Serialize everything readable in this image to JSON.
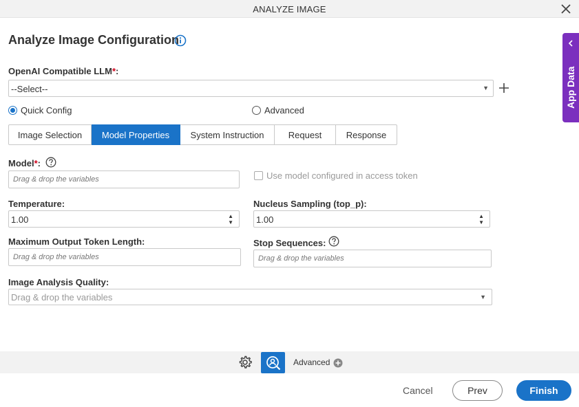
{
  "window": {
    "title": "ANALYZE IMAGE"
  },
  "page": {
    "title": "Analyze Image Configuration"
  },
  "llm": {
    "label": "OpenAI Compatible LLM",
    "required_mark": "*",
    "colon": ":",
    "selected": "--Select--"
  },
  "config_mode": {
    "quick": "Quick Config",
    "advanced": "Advanced",
    "selected": "quick"
  },
  "tabs": [
    {
      "label": "Image Selection"
    },
    {
      "label": "Model Properties",
      "active": true
    },
    {
      "label": "System Instruction"
    },
    {
      "label": "Request"
    },
    {
      "label": "Response"
    }
  ],
  "model": {
    "label": "Model",
    "required_mark": "*",
    "colon": ":",
    "placeholder": "Drag & drop the variables"
  },
  "use_model_token": {
    "label": "Use model configured in access token",
    "checked": false
  },
  "temperature": {
    "label": "Temperature:",
    "value": "1.00"
  },
  "top_p": {
    "label": "Nucleus Sampling (top_p):",
    "value": "1.00"
  },
  "max_tokens": {
    "label": "Maximum Output Token Length:",
    "placeholder": "Drag & drop the variables"
  },
  "stop_sequences": {
    "label": "Stop Sequences:",
    "placeholder": "Drag & drop the variables"
  },
  "quality": {
    "label": "Image Analysis Quality:",
    "placeholder": "Drag & drop the variables"
  },
  "bottom": {
    "advanced_label": "Advanced"
  },
  "footer": {
    "cancel": "Cancel",
    "prev": "Prev",
    "finish": "Finish"
  },
  "side_panel": {
    "label": "App Data"
  },
  "colors": {
    "primary": "#1a73c8",
    "side_panel": "#7b2fbe",
    "required": "#d0021b"
  }
}
